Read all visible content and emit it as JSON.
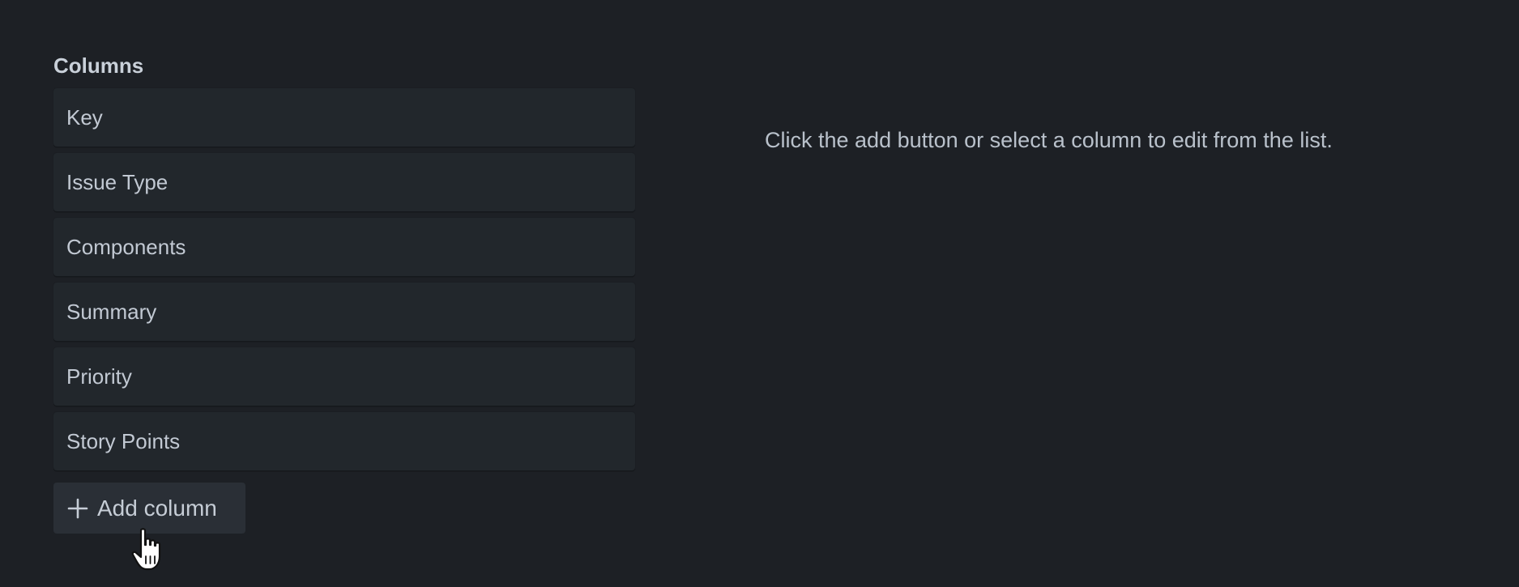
{
  "columns_section": {
    "title": "Columns",
    "items": [
      {
        "label": "Key"
      },
      {
        "label": "Issue Type"
      },
      {
        "label": "Components"
      },
      {
        "label": "Summary"
      },
      {
        "label": "Priority"
      },
      {
        "label": "Story Points"
      }
    ],
    "add_button": {
      "label": "Add column",
      "icon": "plus-icon"
    }
  },
  "detail_panel": {
    "empty_message": "Click the add button or select a column to edit from the list."
  },
  "cursor": {
    "icon": "hand-pointer-icon"
  },
  "colors": {
    "background": "#1d2025",
    "item_background": "#22272c",
    "button_background": "#2a2f36",
    "text": "#c2c9d3"
  }
}
